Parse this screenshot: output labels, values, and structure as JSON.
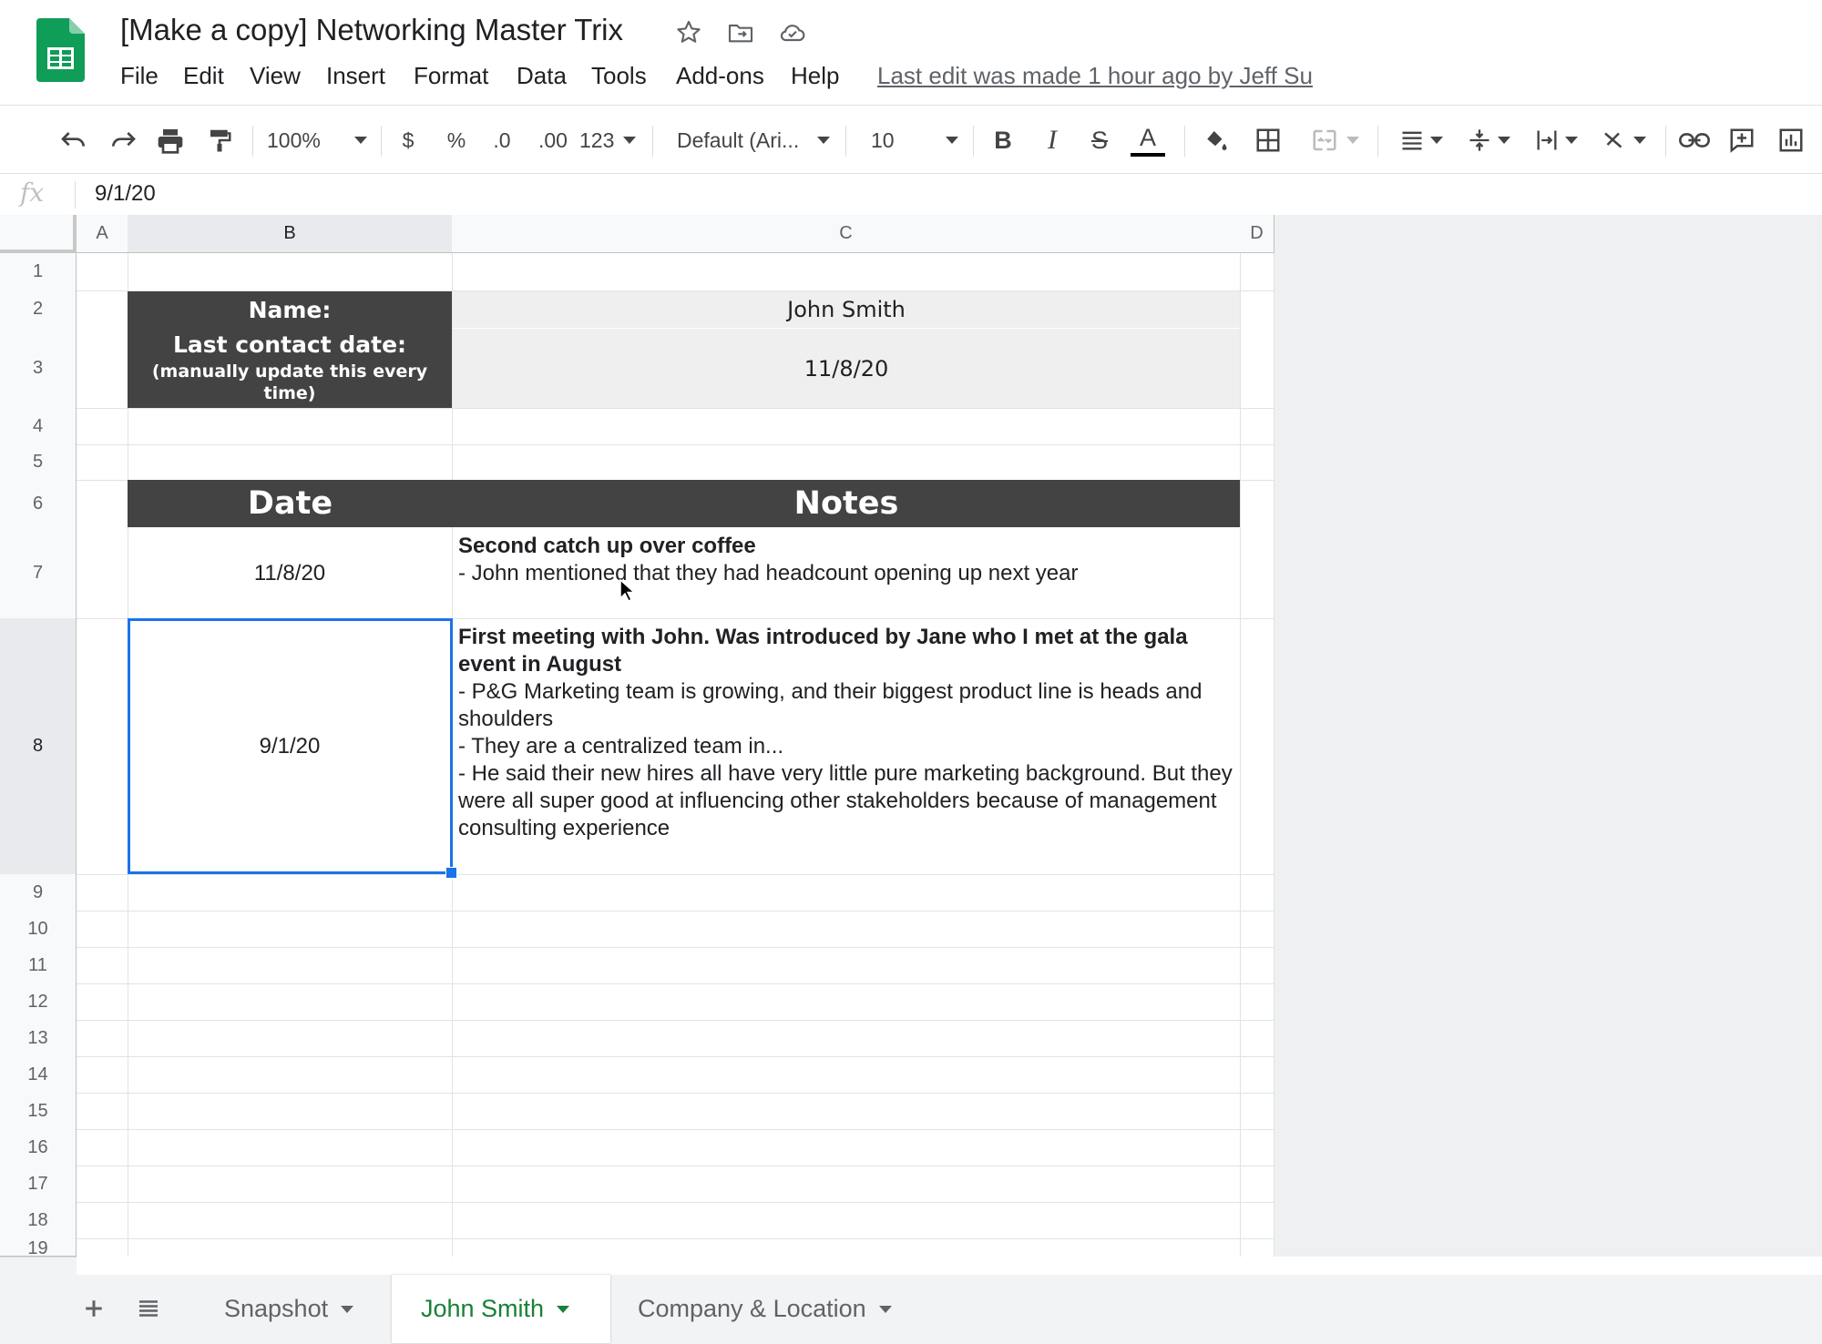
{
  "app": {
    "doc_title": "[Make a copy] Networking Master Trix",
    "last_edit": "Last edit was made 1 hour ago by Jeff Su",
    "menu": [
      "File",
      "Edit",
      "View",
      "Insert",
      "Format",
      "Data",
      "Tools",
      "Add-ons",
      "Help"
    ]
  },
  "toolbar": {
    "zoom": "100%",
    "currency": "$",
    "percent": "%",
    "decrease_decimal": ".0",
    "increase_decimal": ".00",
    "more_formats": "123",
    "font": "Default (Ari...",
    "font_size": "10",
    "bold": "B",
    "italic": "I",
    "strike": "S",
    "text_color": "A"
  },
  "formula_bar": {
    "fx": "fx",
    "value": "9/1/20"
  },
  "columns": [
    "A",
    "B",
    "C",
    "D"
  ],
  "rows": [
    "1",
    "2",
    "3",
    "4",
    "5",
    "6",
    "7",
    "8",
    "9",
    "10",
    "11",
    "12",
    "13",
    "14",
    "15",
    "16",
    "17",
    "18",
    "19"
  ],
  "sheet": {
    "name_label": "Name:",
    "last_contact_label": "Last contact date:",
    "manual_note": "(manually update this every time)",
    "name_value": "John Smith",
    "last_contact_value": "11/8/20",
    "date_header": "Date",
    "notes_header": "Notes",
    "entries": [
      {
        "date": "11/8/20",
        "title": "Second catch up over coffee",
        "lines": [
          " - John mentioned that they had headcount opening up next year"
        ]
      },
      {
        "date": "9/1/20",
        "title": "First meeting with John. Was introduced by Jane who I met at the gala event in August",
        "lines": [
          " - P&G Marketing team is growing, and their biggest product line is heads and shoulders",
          " - They are a centralized team in...",
          " - He said their new hires all have very little pure marketing background. But they were all super good at influencing other stakeholders because of management consulting experience"
        ]
      }
    ]
  },
  "tabs": [
    "Snapshot",
    "John Smith",
    "Company & Location"
  ],
  "active_tab": "John Smith",
  "colors": {
    "dark_header": "#434343",
    "selection": "#1a73e8",
    "active_tab": "#188038",
    "sheets_green": "#0f9d58"
  },
  "icons": [
    "sheets-logo-icon",
    "star-icon",
    "move-folder-icon",
    "cloud-status-icon",
    "undo-icon",
    "redo-icon",
    "print-icon",
    "paint-format-icon",
    "fill-color-icon",
    "borders-icon",
    "merge-cells-icon",
    "align-icon",
    "vertical-align-icon",
    "text-wrap-icon",
    "text-rotate-icon",
    "link-icon",
    "comment-icon",
    "chart-icon",
    "add-sheet-icon",
    "all-sheets-icon"
  ]
}
